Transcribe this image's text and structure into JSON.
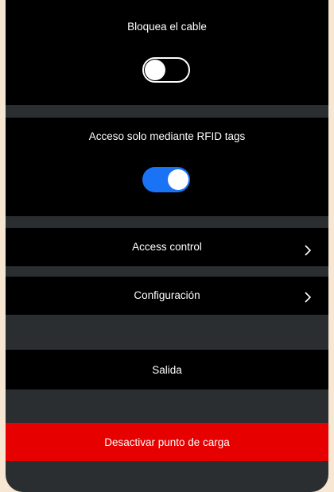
{
  "settings": {
    "lock_cable": {
      "label": "Bloquea el cable",
      "enabled": false
    },
    "rfid_only": {
      "label": "Acceso solo mediante RFID tags",
      "enabled": true
    }
  },
  "menu": {
    "access_control_label": "Access control",
    "configuration_label": "Configuración",
    "exit_label": "Salida"
  },
  "danger_action": {
    "label": "Desactivar punto de carga"
  },
  "colors": {
    "page_background": "#f7e6d2",
    "panel_background": "#2b2e31",
    "block_background": "#000000",
    "toggle_on": "#1a73f5",
    "danger": "#e60000",
    "text": "#ffffff"
  },
  "icons": {
    "row_arrow": "chevron-right-icon"
  }
}
